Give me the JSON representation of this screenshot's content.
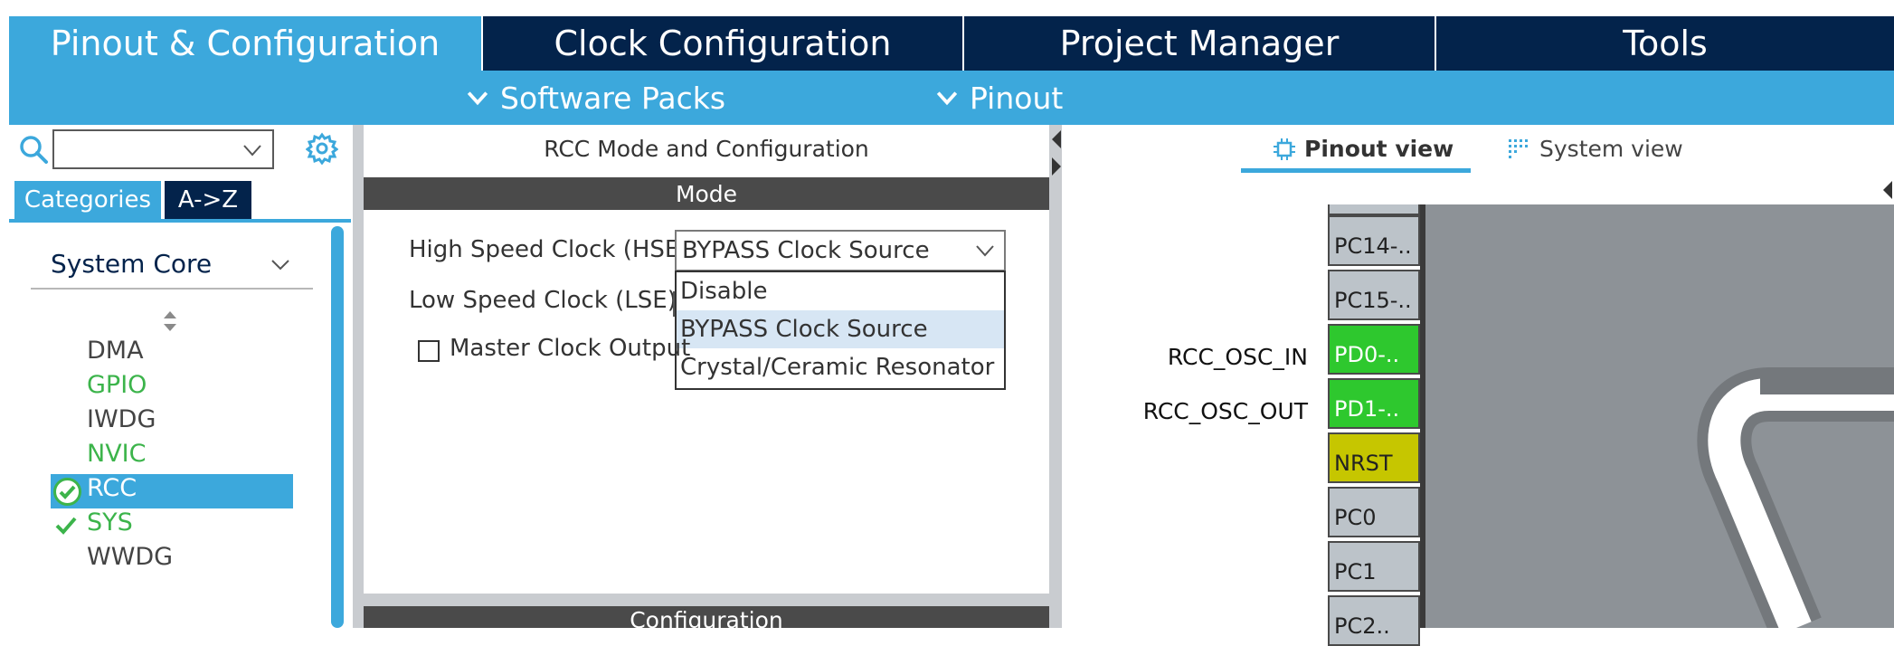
{
  "top_tabs": {
    "pinout": "Pinout & Configuration",
    "clock": "Clock Configuration",
    "project": "Project Manager",
    "tools": "Tools"
  },
  "sub_menu": {
    "software_packs": "Software Packs",
    "pinout": "Pinout"
  },
  "left_panel": {
    "search": {
      "value": "",
      "placeholder": ""
    },
    "tabs": {
      "categories": "Categories",
      "az": "A->Z"
    },
    "group": "System Core",
    "items": [
      {
        "label": "DMA",
        "status": "none"
      },
      {
        "label": "GPIO",
        "status": "green"
      },
      {
        "label": "IWDG",
        "status": "none"
      },
      {
        "label": "NVIC",
        "status": "green"
      },
      {
        "label": "RCC",
        "status": "selected-ok"
      },
      {
        "label": "SYS",
        "status": "ok"
      },
      {
        "label": "WWDG",
        "status": "none"
      }
    ]
  },
  "mode_panel": {
    "title": "RCC Mode and Configuration",
    "mode_header": "Mode",
    "hse_label": "High Speed Clock (HSE)",
    "hse_value": "BYPASS Clock Source",
    "lse_label": "Low Speed Clock (LSE)",
    "dropdown_options": [
      "Disable",
      "BYPASS Clock Source",
      "Crystal/Ceramic Resonator"
    ],
    "dropdown_selected": "BYPASS Clock Source",
    "mco_label": "Master Clock Output",
    "mco_checked": false,
    "config_header": "Configuration"
  },
  "right_panel": {
    "pinout_view": "Pinout view",
    "system_view": "System view",
    "pins": [
      {
        "name": "PC14-..",
        "label": "",
        "state": "default"
      },
      {
        "name": "PC15-..",
        "label": "",
        "state": "default"
      },
      {
        "name": "PD0-..",
        "label": "RCC_OSC_IN",
        "state": "green"
      },
      {
        "name": "PD1-..",
        "label": "RCC_OSC_OUT",
        "state": "green"
      },
      {
        "name": "NRST",
        "label": "",
        "state": "yellow"
      },
      {
        "name": "PC0",
        "label": "",
        "state": "default"
      },
      {
        "name": "PC1",
        "label": "",
        "state": "default"
      },
      {
        "name": "PC2..",
        "label": "",
        "state": "default"
      }
    ]
  },
  "colors": {
    "accent": "#3ca8dc",
    "navy": "#03234b",
    "pin_green": "#2ec82e",
    "pin_yellow": "#c6c600",
    "item_green": "#3cb44b"
  }
}
